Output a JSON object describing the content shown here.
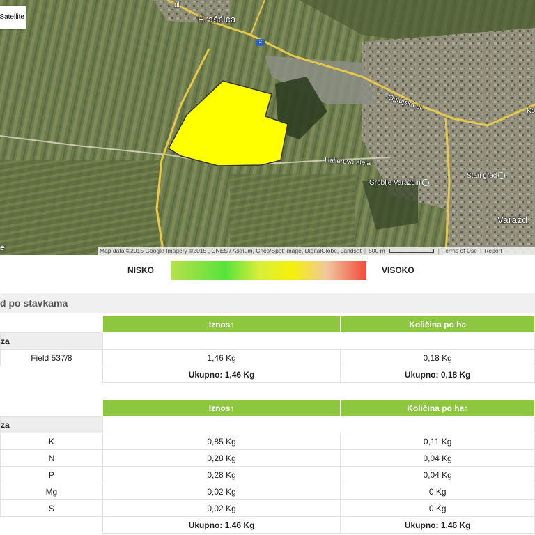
{
  "map": {
    "type_button": "Satellite",
    "labels": {
      "village": "Hrašćica",
      "route": "2",
      "street1": "Optujska ul",
      "street2": "Hallerova aleja",
      "poi1": "Groblje Varaždin",
      "poi2": "Stari grad",
      "city": "Varažd",
      "edge": "Ko",
      "ul_top": "ul."
    },
    "attribution": {
      "data": "Map data ©2015 Google Imagery ©2015 , CNES / Astrium, Cnes/Spot Image, DigitalGlobe, Landsat",
      "scale": "500 m",
      "terms": "Terms of Use",
      "report": "Report"
    },
    "colors": {
      "field": "#ffff00",
      "field_border": "#333333",
      "road": "#e6c84a"
    }
  },
  "legend": {
    "low": "NISKO",
    "high": "VISOKO",
    "gradient": [
      "#b8e24a",
      "#57e33a",
      "#d7ee3a",
      "#f5f00a",
      "#f0c6a0",
      "#f14a3a"
    ]
  },
  "section": {
    "title": "d po stavkama"
  },
  "table1": {
    "headers": [
      "Iznos↑",
      "Količina po ha"
    ],
    "group": "za",
    "rows": [
      {
        "name": "Field 537/8",
        "iznos": "1,46 Kg",
        "kolicina": "0,18 Kg"
      }
    ],
    "total": {
      "iznos": "Ukupno: 1,46 Kg",
      "kolicina": "Ukupno: 0,18 Kg"
    }
  },
  "table2": {
    "headers": [
      "Iznos↑",
      "Količina po ha↑"
    ],
    "group": "za",
    "rows": [
      {
        "name": "K",
        "iznos": "0,85 Kg",
        "kolicina": "0,11 Kg"
      },
      {
        "name": "N",
        "iznos": "0,28 Kg",
        "kolicina": "0,04 Kg"
      },
      {
        "name": "P",
        "iznos": "0,28 Kg",
        "kolicina": "0,04 Kg"
      },
      {
        "name": "Mg",
        "iznos": "0,02 Kg",
        "kolicina": "0 Kg"
      },
      {
        "name": "S",
        "iznos": "0,02 Kg",
        "kolicina": "0 Kg"
      }
    ],
    "total": {
      "iznos": "Ukupno: 1,46 Kg",
      "kolicina": "Ukupno: 1,46 Kg"
    }
  },
  "accent": "#8dc63f"
}
